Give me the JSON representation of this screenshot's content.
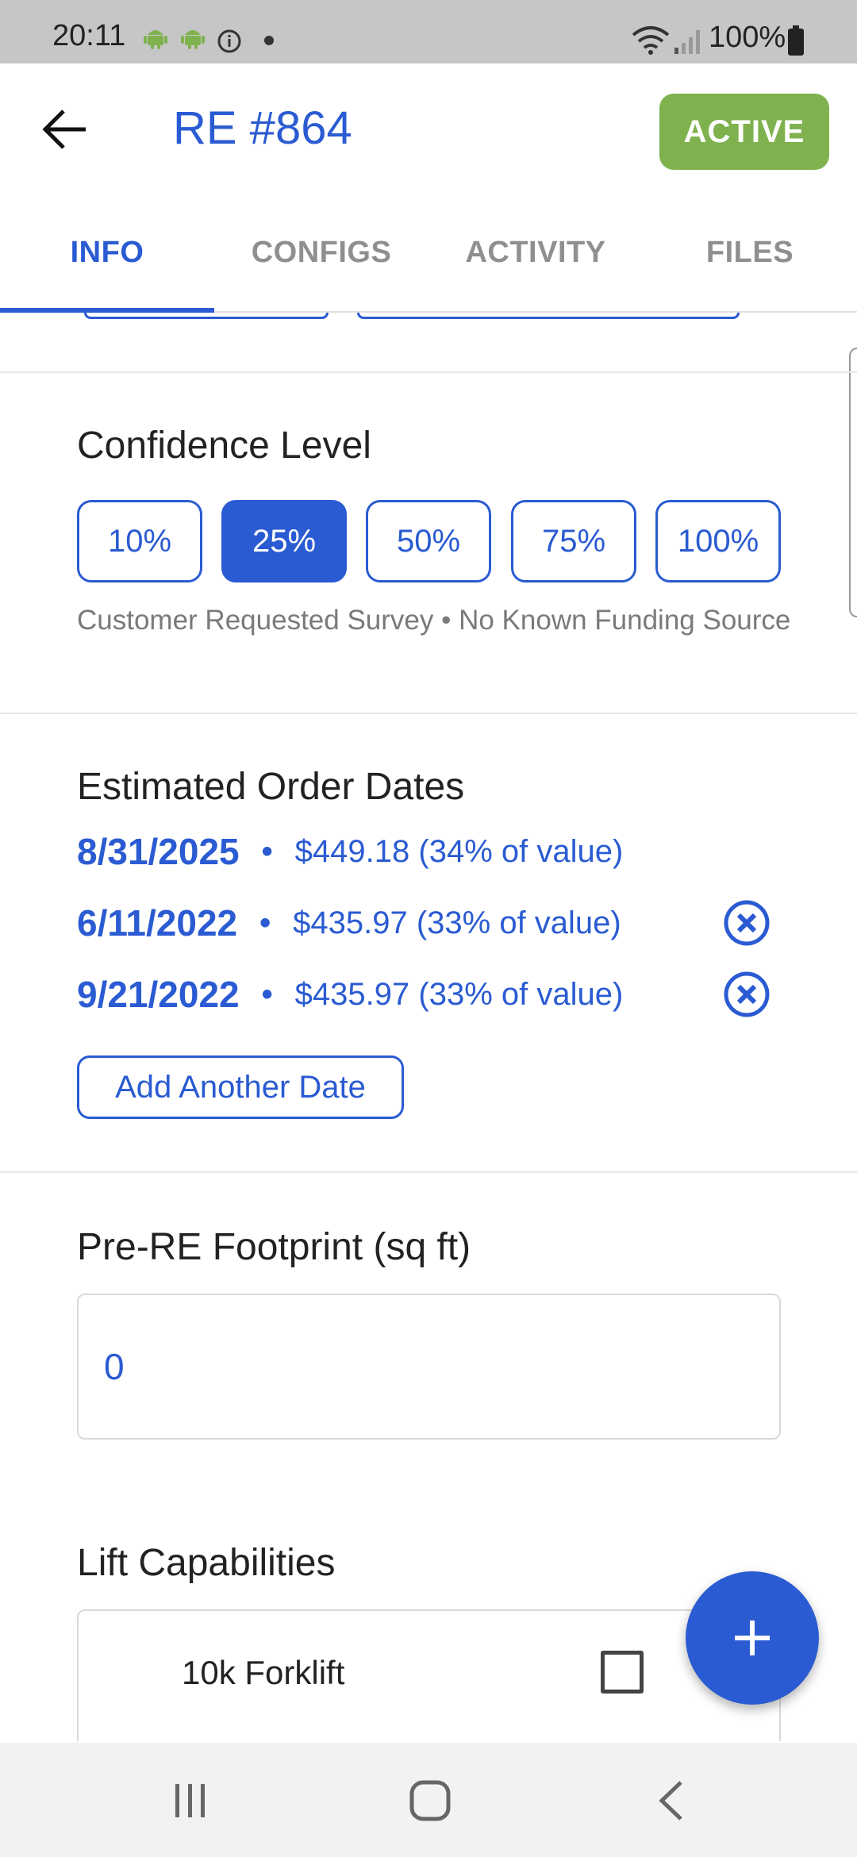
{
  "status_bar": {
    "time": "20:11",
    "battery": "100%",
    "icons": [
      "android-icon",
      "android-icon",
      "info-icon",
      "wifi-icon",
      "signal-icon",
      "battery-icon"
    ]
  },
  "app_bar": {
    "title": "RE #864",
    "status": "ACTIVE",
    "status_color": "#7fb24e",
    "accent_color": "#2a5bd2"
  },
  "tabs": [
    {
      "label": "INFO",
      "active": true
    },
    {
      "label": "CONFIGS",
      "active": false
    },
    {
      "label": "ACTIVITY",
      "active": false
    },
    {
      "label": "FILES",
      "active": false
    }
  ],
  "confidence": {
    "title": "Confidence Level",
    "options": [
      "10%",
      "25%",
      "50%",
      "75%",
      "100%"
    ],
    "selected": "25%",
    "description": "Customer Requested Survey • No Known Funding Source"
  },
  "order_dates": {
    "title": "Estimated Order Dates",
    "separator": "•",
    "rows": [
      {
        "date": "8/31/2025",
        "amount": "$449.18 (34% of value)",
        "removable": false
      },
      {
        "date": "6/11/2022",
        "amount": "$435.97 (33% of value)",
        "removable": true
      },
      {
        "date": "9/21/2022",
        "amount": "$435.97 (33% of value)",
        "removable": true
      }
    ],
    "add_label": "Add Another Date"
  },
  "footprint": {
    "title": "Pre-RE Footprint (sq ft)",
    "value": "0"
  },
  "lift": {
    "title": "Lift Capabilities",
    "items": [
      {
        "label": "10k Forklift",
        "checked": false
      }
    ]
  }
}
